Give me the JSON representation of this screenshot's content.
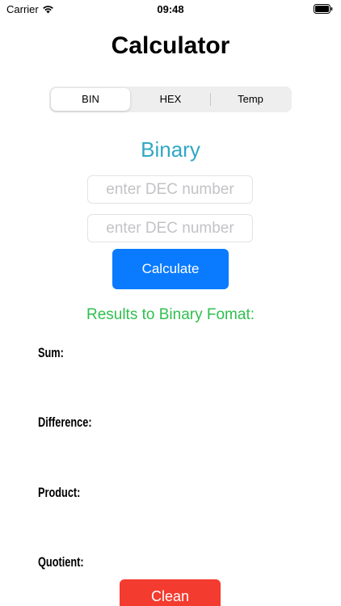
{
  "status_bar": {
    "carrier": "Carrier",
    "time": "09:48"
  },
  "title": "Calculator",
  "segments": [
    {
      "label": "BIN",
      "selected": true
    },
    {
      "label": "HEX",
      "selected": false
    },
    {
      "label": "Temp",
      "selected": false
    }
  ],
  "subtitle": "Binary",
  "inputs": {
    "first": {
      "value": "",
      "placeholder": "enter DEC number"
    },
    "second": {
      "value": "",
      "placeholder": "enter DEC number"
    }
  },
  "calculate_label": "Calculate",
  "results_heading": "Results to Binary Fomat:",
  "results": {
    "sum_label": "Sum:",
    "difference_label": "Difference:",
    "product_label": "Product:",
    "quotient_label": "Quotient:"
  },
  "clean_label": "Clean",
  "colors": {
    "accent_blue": "#0a7bff",
    "subtitle_teal": "#2fa8c5",
    "results_green": "#2fbf4e",
    "clean_red": "#f33b2f"
  },
  "icons": [
    "wifi-icon",
    "battery-icon"
  ]
}
